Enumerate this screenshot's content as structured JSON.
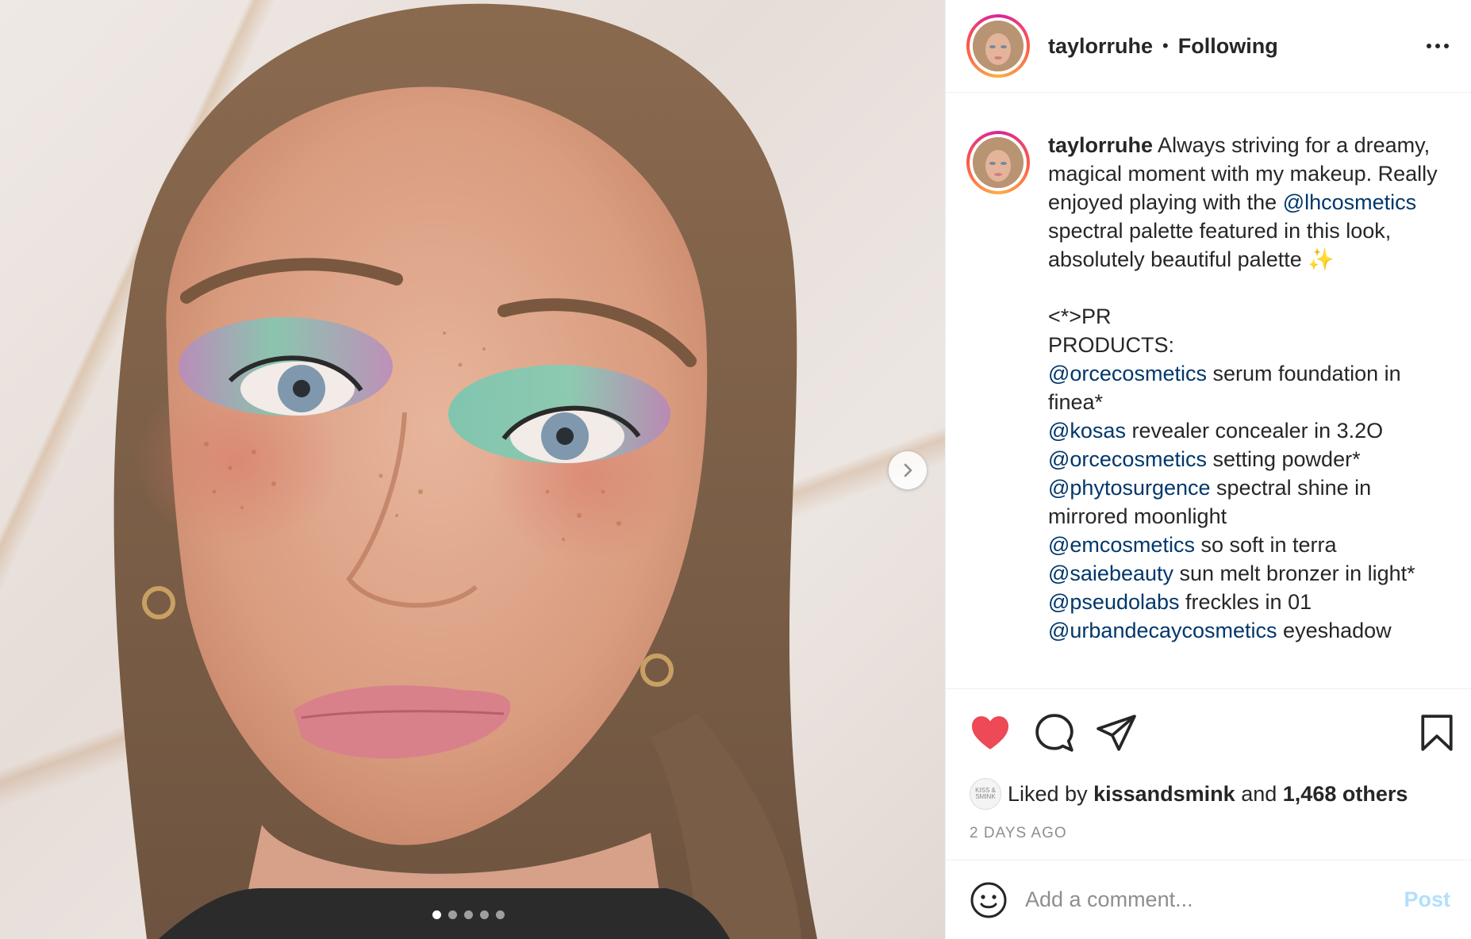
{
  "colors": {
    "like_red": "#ed4956",
    "mention_blue": "#00376b",
    "post_button_disabled": "#b2dffc",
    "muted_text": "#8e8e8e"
  },
  "media": {
    "carousel_dots": 5,
    "active_dot": 1,
    "next_icon": "chevron-right-icon"
  },
  "header": {
    "username": "taylorruhe",
    "separator": "•",
    "follow_status": "Following",
    "more_icon": "more-options-icon"
  },
  "caption": {
    "username": "taylorruhe",
    "segments": [
      {
        "text": " Always striving for a dreamy, magical moment with my makeup. Really enjoyed playing with the "
      },
      {
        "mention": "@lhcosmetics"
      },
      {
        "text": " spectral palette featured in this look, absolutely beautiful palette ✨\n\n<*>PR\nPRODUCTS:\n"
      },
      {
        "mention": "@orcecosmetics"
      },
      {
        "text": " serum foundation in finea*\n"
      },
      {
        "mention": "@kosas"
      },
      {
        "text": " revealer concealer in 3.2O\n"
      },
      {
        "mention": "@orcecosmetics"
      },
      {
        "text": " setting powder*\n"
      },
      {
        "mention": "@phytosurgence"
      },
      {
        "text": " spectral shine in mirrored moonlight\n"
      },
      {
        "mention": "@emcosmetics"
      },
      {
        "text": " so soft in terra\n"
      },
      {
        "mention": "@saiebeauty"
      },
      {
        "text": " sun melt bronzer in light*\n"
      },
      {
        "mention": "@pseudolabs"
      },
      {
        "text": " freckles in 01\n"
      },
      {
        "mention": "@urbandecaycosmetics"
      },
      {
        "text": " eyeshadow"
      }
    ]
  },
  "actions": {
    "like_icon": "heart-filled-icon",
    "comment_icon": "comment-icon",
    "share_icon": "share-icon",
    "save_icon": "bookmark-icon"
  },
  "likes": {
    "prefix": "Liked by",
    "user": "kissandsmink",
    "conjunction": "and",
    "others": "1,468 others",
    "mini_avatar_text": "KISS & SMINK"
  },
  "timestamp": "2 DAYS AGO",
  "comment": {
    "emoji_icon": "emoji-smile-icon",
    "placeholder": "Add a comment...",
    "post_label": "Post"
  }
}
